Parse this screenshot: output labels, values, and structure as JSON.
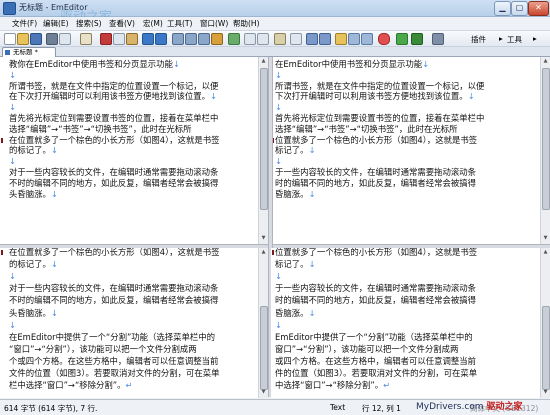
{
  "window": {
    "title": "无标题 - EmEditor",
    "ghost": "驱动之家"
  },
  "menu": [
    "文件(F)",
    "编辑(E)",
    "搜索(S)",
    "查看(V)",
    "宏(M)",
    "工具(T)",
    "窗口(W)",
    "帮助(H)"
  ],
  "toolbar": {
    "plugins": "插件",
    "tools": "工具"
  },
  "tab": {
    "label": "无标题 *"
  },
  "colors": {
    "accent": "#4e8ee0",
    "bookmark": "#7b1a1a"
  },
  "panes": {
    "top_left": [
      "教你在EmEditor中使用书签和分页显示功能↓",
      "↓",
      "所谓书签，就是在文件中指定的位置设置一个标记，以便",
      "在下次打开编辑时可以利用该书签方便地找到该位置。↓",
      "↓",
      "首先将光标定位到需要设置书签的位置，接着在菜单栏中",
      "选择“编辑”→“书签”→“切换书签”，此时在光标所",
      "在位置就多了一个棕色的小长方形（如图4），这就是书签",
      "的标记了。↓",
      "↓",
      "对于一些内容较长的文件，在编辑时通常需要拖动滚动条",
      "不时的编辑不同的地方，如此反复，编辑者经常会被搞得",
      "头昏脑涨。↓"
    ],
    "top_right": [
      "在EmEditor中使用书签和分页显示功能↓",
      "↓",
      "所谓书签，就是在文件中指定的位置设置一个标记，以便",
      "下次打开编辑时可以利用该书签方便地找到该位置。↓",
      "↓",
      "首先将光标定位到需要设置书签的位置，接着在菜单栏中",
      "选择“编辑”→“书签”→“切换书签”，此时在光标所",
      "位置就多了一个棕色的小长方形（如图4），这就是书签",
      "标记了。↓",
      "↓",
      "于一些内容较长的文件，在编辑时通常需要拖动滚动条",
      "时的编辑不同的地方，如此反复，编辑者经常会被搞得",
      "昏脑涨。↓"
    ],
    "bottom_left": [
      "在位置就多了一个棕色的小长方形（如图4），这就是书签",
      "的标记了。↓",
      "↓",
      "对于一些内容较长的文件，在编辑时通常需要拖动滚动条",
      "不时的编辑不同的地方，如此反复，编辑者经常会被搞得",
      "头昏脑涨。↓",
      "↓",
      "在EmEditor中提供了一个“分割”功能（选择菜单栏中的",
      "“窗口”→“分割”），该功能可以把一个文件分割成两",
      "个或四个方格。在这些方格中，编辑者可以任意调整当前",
      "文件的位置（如图3）。若要取消对文件的分割，可在菜单",
      "栏中选择“窗口”→“移除分割”。↵"
    ],
    "bottom_right": [
      "位置就多了一个棕色的小长方形（如图4），这就是书签",
      "标记了。↓",
      "↓",
      "于一些内容较长的文件，在编辑时通常需要拖动滚动条",
      "时的编辑不同的地方，如此反复，编辑者经常会被搞得",
      "昏脑涨。↓",
      "↓",
      "EmEditor中提供了一个“分割”功能（选择菜单栏中的",
      "窗口”→“分割”），该功能可以把一个文件分割成两",
      "或四个方格。在这些方格中，编辑者可以任意调整当前",
      "件的位置（如图3）。若要取消对文件的分割，可在菜单",
      "中选择“窗口”→“移除分割”。↵"
    ]
  },
  "status": {
    "left": "614 字节 (614 字节), 7 行.",
    "mode": "Text",
    "pos": "行 12, 列 1",
    "encoding": "简体中文 (GB2312)"
  },
  "watermark": {
    "site": "MyDrivers.com",
    "brand": "驱动之家"
  }
}
